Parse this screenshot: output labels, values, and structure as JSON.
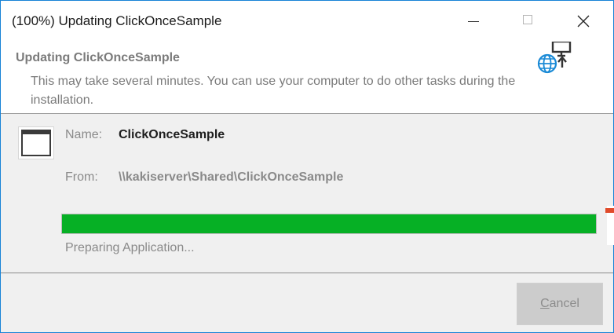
{
  "window": {
    "title": "(100%) Updating ClickOnceSample",
    "accent_color": "#1783d7"
  },
  "title_controls": {
    "minimize_icon": "minimize-icon",
    "maximize_icon": "maximize-icon",
    "close_icon": "close-icon"
  },
  "header": {
    "title": "Updating ClickOnceSample",
    "description": "This may take several minutes. You can use your computer to do other tasks during the installation.",
    "icon": "globe-update-icon"
  },
  "details": {
    "app_icon": "application-window-icon",
    "name_label": "Name:",
    "name_value": "ClickOnceSample",
    "from_label": "From:",
    "from_value": "\\\\kakiserver\\Shared\\ClickOnceSample"
  },
  "progress": {
    "percent": 100,
    "color": "#06b025",
    "status": "Preparing Application..."
  },
  "buttons": {
    "cancel_mnemonic": "C",
    "cancel_rest": "ancel",
    "cancel_enabled": false
  }
}
